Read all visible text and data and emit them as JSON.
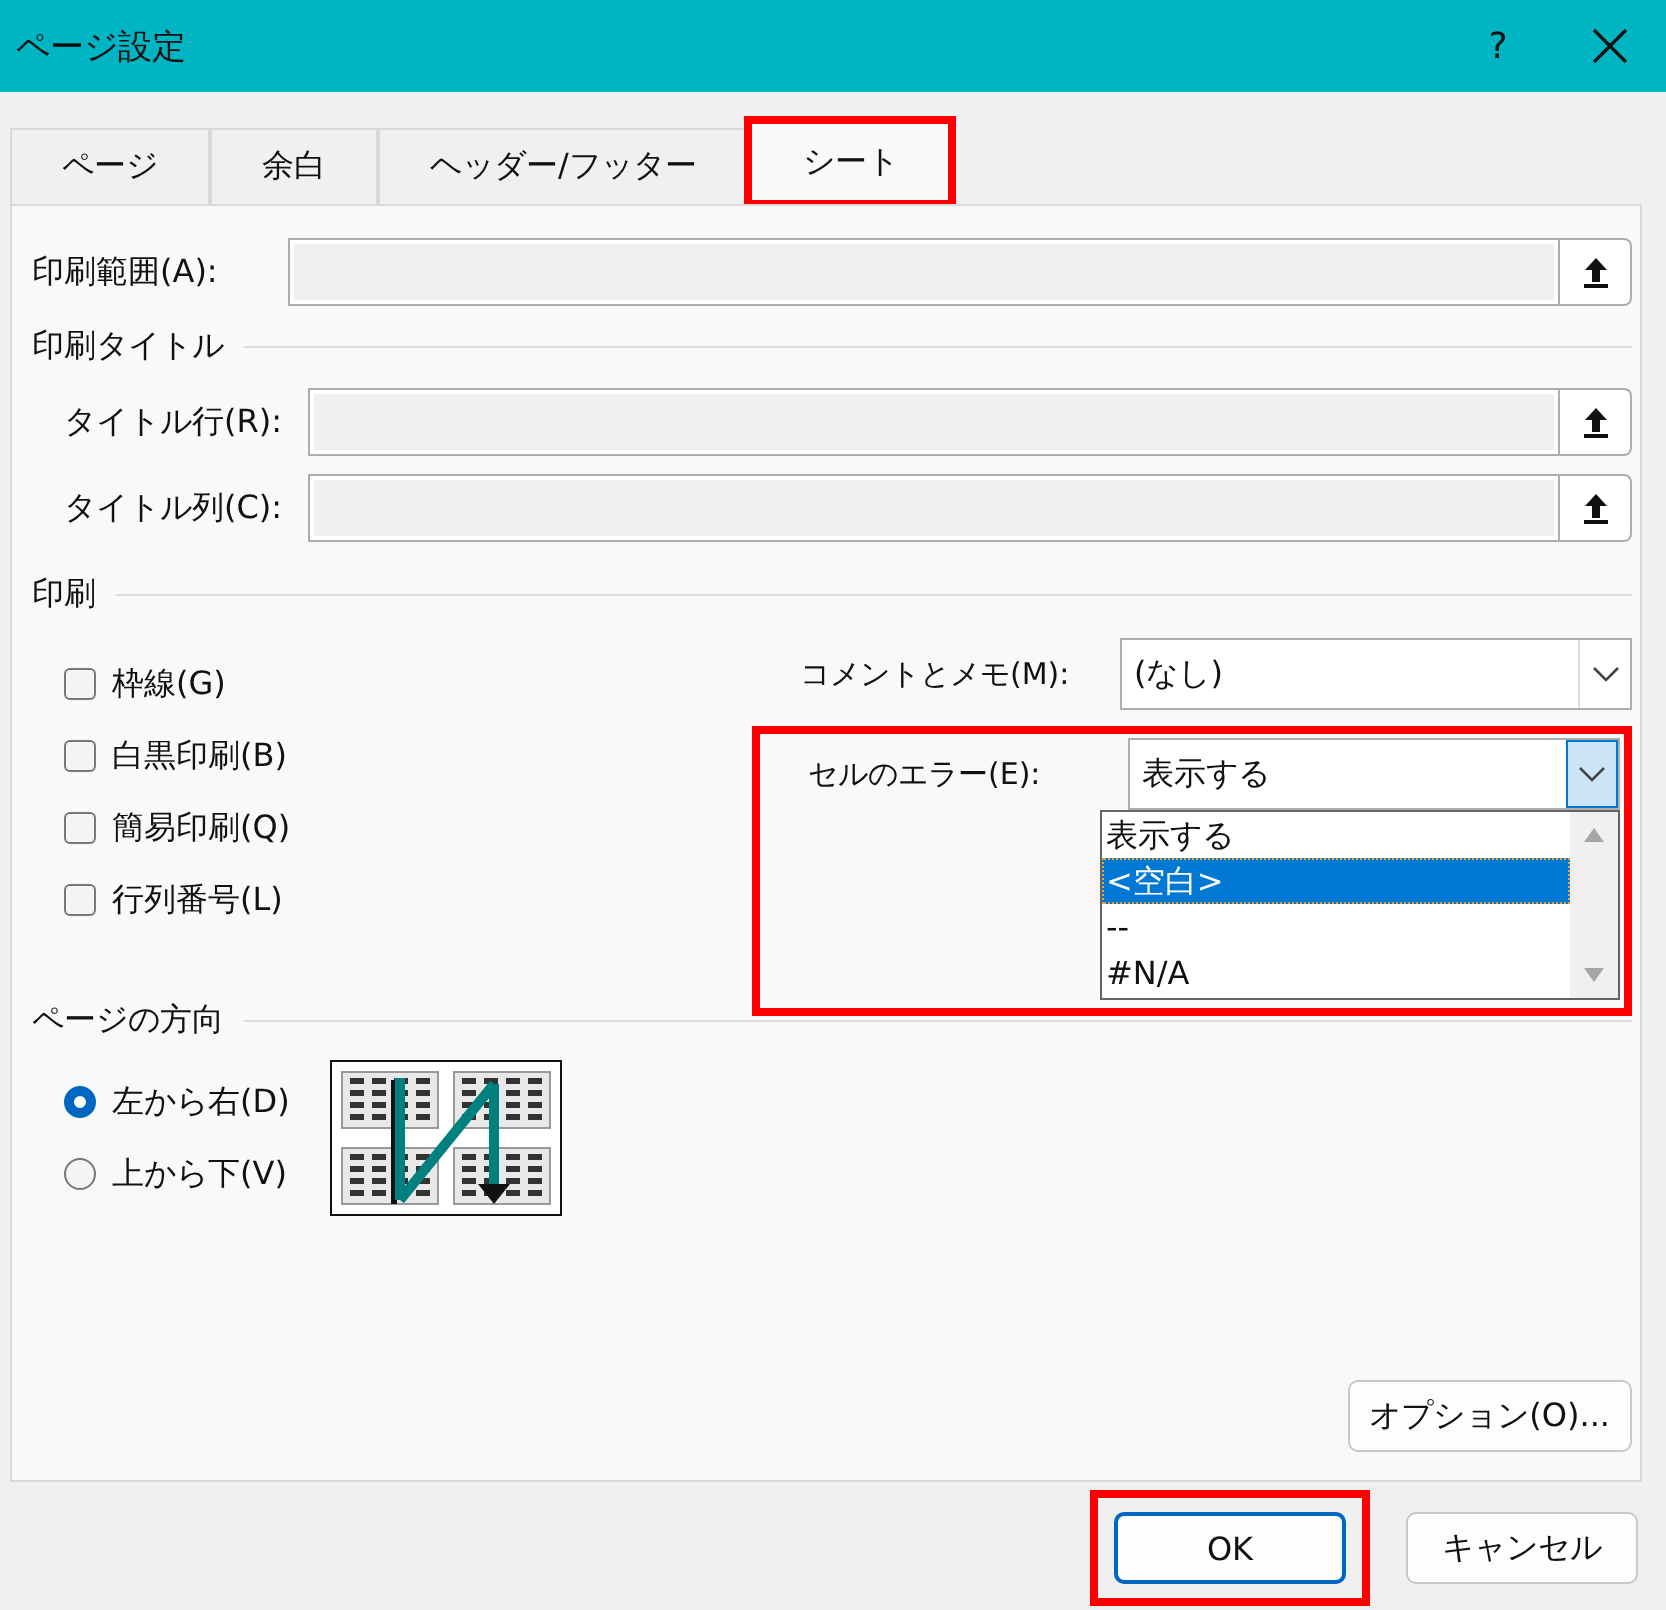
{
  "window": {
    "title": "ページ設定",
    "help": "?"
  },
  "tabs": [
    {
      "label": "ページ",
      "selected": false,
      "highlighted": false
    },
    {
      "label": "余白",
      "selected": false,
      "highlighted": false
    },
    {
      "label": "ヘッダー/フッター",
      "selected": false,
      "highlighted": false
    },
    {
      "label": "シート",
      "selected": true,
      "highlighted": true
    }
  ],
  "print_area": {
    "label": "印刷範囲(A):"
  },
  "print_titles": {
    "heading": "印刷タイトル",
    "fields": [
      {
        "label": "タイトル行(R):"
      },
      {
        "label": "タイトル列(C):"
      }
    ]
  },
  "print": {
    "heading": "印刷",
    "options": [
      {
        "label": "枠線(G)",
        "checked": false
      },
      {
        "label": "白黒印刷(B)",
        "checked": false
      },
      {
        "label": "簡易印刷(Q)",
        "checked": false
      },
      {
        "label": "行列番号(L)",
        "checked": false
      }
    ],
    "comments": {
      "label": "コメントとメモ(M):",
      "value": "(なし)"
    },
    "cell_errors": {
      "label": "セルのエラー(E):",
      "value": "表示する",
      "expanded": true,
      "highlighted": true,
      "options": [
        {
          "label": "表示する",
          "highlighted": false
        },
        {
          "label": "<空白>",
          "highlighted": true
        },
        {
          "label": "--",
          "highlighted": false
        },
        {
          "label": "#N/A",
          "highlighted": false
        }
      ]
    }
  },
  "page_order": {
    "heading": "ページの方向",
    "options": [
      {
        "label": "左から右(D)",
        "selected": true
      },
      {
        "label": "上から下(V)",
        "selected": false
      }
    ]
  },
  "options_button": "オプション(O)...",
  "buttons": [
    {
      "label": "OK",
      "default": true,
      "highlighted": true
    },
    {
      "label": "キャンセル",
      "default": false,
      "highlighted": false
    }
  ]
}
